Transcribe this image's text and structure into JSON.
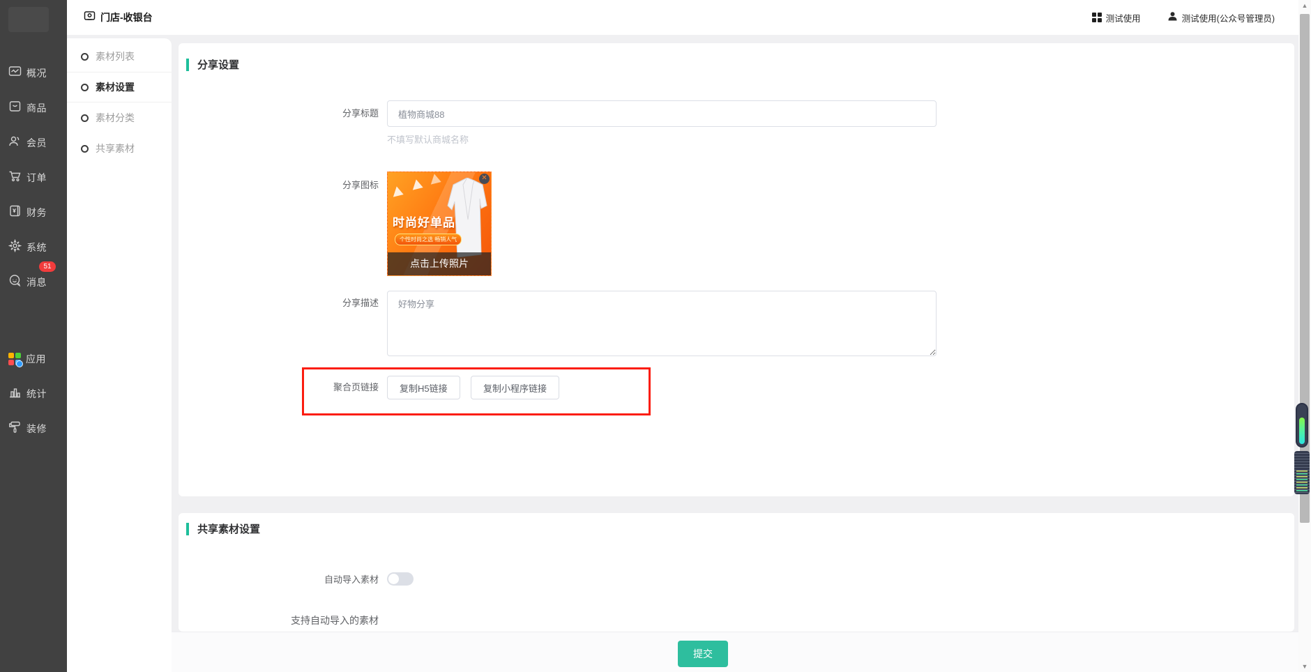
{
  "header": {
    "title": "门店-收银台",
    "workspace_label": "测试使用",
    "user_label": "测试使用(公众号管理员)"
  },
  "sidebar": {
    "message_badge": "51",
    "items": [
      {
        "label": "概况",
        "icon": "overview-icon"
      },
      {
        "label": "商品",
        "icon": "goods-icon"
      },
      {
        "label": "会员",
        "icon": "members-icon"
      },
      {
        "label": "订单",
        "icon": "orders-icon"
      },
      {
        "label": "财务",
        "icon": "finance-icon"
      },
      {
        "label": "系统",
        "icon": "system-icon"
      },
      {
        "label": "消息",
        "icon": "message-icon"
      },
      {
        "label": "应用",
        "icon": "apps-icon"
      },
      {
        "label": "统计",
        "icon": "stats-icon"
      },
      {
        "label": "装修",
        "icon": "decorate-icon"
      }
    ]
  },
  "submenu": {
    "items": [
      {
        "label": "素材列表",
        "active": false
      },
      {
        "label": "素材设置",
        "active": true
      },
      {
        "label": "素材分类",
        "active": false
      },
      {
        "label": "共享素材",
        "active": false
      }
    ]
  },
  "share_section": {
    "title": "分享设置",
    "share_title_label": "分享标题",
    "share_title_value": "植物商城88",
    "share_title_hint": "不填写默认商城名称",
    "share_icon_label": "分享图标",
    "promo_headline": "时尚好单品",
    "promo_badge": "个性时尚之选 畅销人气",
    "upload_overlay_text": "点击上传照片",
    "close_glyph": "✕",
    "share_desc_label": "分享描述",
    "share_desc_value": "好物分享",
    "aggregate_link_label": "聚合页链接",
    "copy_h5_button": "复制H5链接",
    "copy_mini_button": "复制小程序链接"
  },
  "shared_material_section": {
    "title": "共享素材设置",
    "auto_import_label": "自动导入素材",
    "auto_import_enabled": false,
    "support_text": "支持自动导入的素材"
  },
  "footer": {
    "submit_label": "提交"
  },
  "scrollbar": {
    "up_glyph": "▲",
    "down_glyph": "▼"
  },
  "colors": {
    "accent_green": "#1ebe9b",
    "submit_green": "#2ebe9e",
    "annotation_red": "#fb1d10",
    "badge_red": "#f23c3c",
    "sidebar_dark": "#414141",
    "promo_orange": "#ff7a12"
  }
}
